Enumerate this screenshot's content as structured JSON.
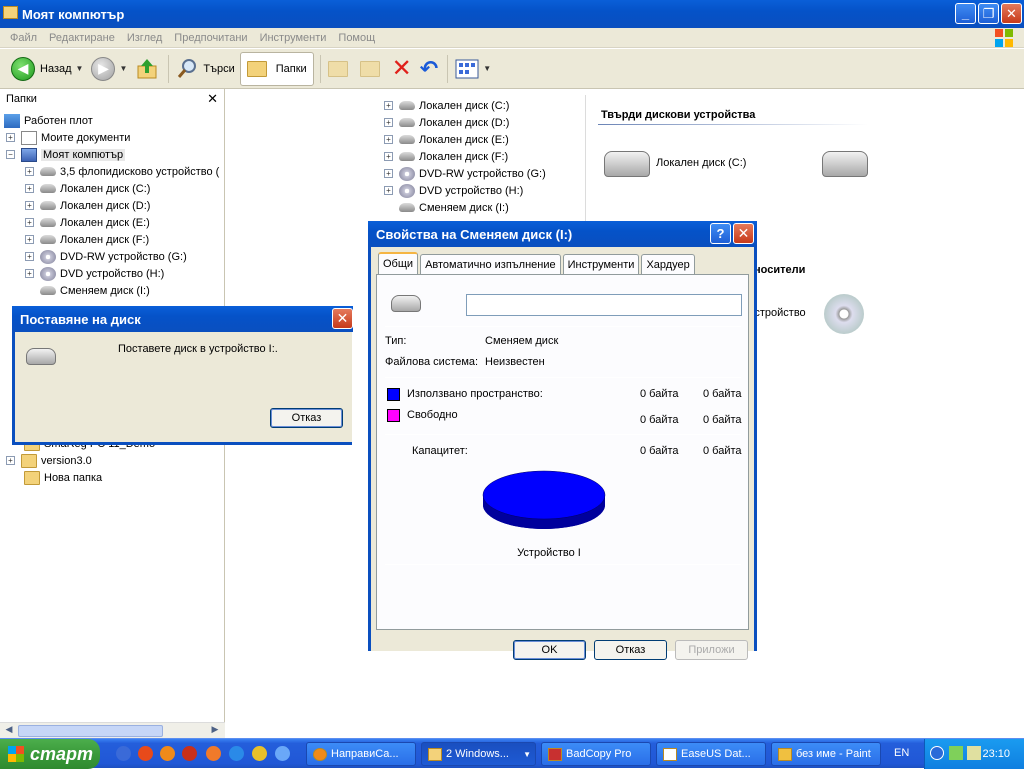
{
  "window": {
    "title": "Моят компютър"
  },
  "menu": [
    "Файл",
    "Редактиране",
    "Изглед",
    "Предпочитани",
    "Инструменти",
    "Помощ"
  ],
  "toolbar": {
    "back": "Назад",
    "search": "Търси",
    "folders": "Папки"
  },
  "folders_pane": {
    "title": "Папки",
    "items": [
      {
        "label": "Работен плот",
        "icon": "desktop-icon"
      },
      {
        "label": "Моите документи",
        "icon": "documents-icon"
      },
      {
        "label": "Моят компютър",
        "icon": "computer-icon"
      },
      {
        "label": "3,5 флопидисково устройство (",
        "icon": "floppy-icon"
      },
      {
        "label": "Локален диск (C:)",
        "icon": "drive-icon"
      },
      {
        "label": "Локален диск (D:)",
        "icon": "drive-icon"
      },
      {
        "label": "Локален диск (E:)",
        "icon": "drive-icon"
      },
      {
        "label": "Локален диск (F:)",
        "icon": "drive-icon"
      },
      {
        "label": "DVD-RW устройство (G:)",
        "icon": "cd-icon"
      },
      {
        "label": "DVD устройство (H:)",
        "icon": "cd-icon"
      },
      {
        "label": "Сменяем диск (I:)",
        "icon": "drive-icon"
      },
      {
        "label": "SmaReg PC 11_Demo",
        "icon": "folder-icon"
      },
      {
        "label": "version3.0",
        "icon": "folder-icon"
      },
      {
        "label": "Нова папка",
        "icon": "folder-icon"
      }
    ]
  },
  "content": {
    "tree_items": [
      "Локален диск (C:)",
      "Локален диск (D:)",
      "Локален диск (E:)",
      "Локален диск (F:)",
      "DVD-RW устройство (G:)",
      "DVD устройство (H:)",
      "Сменяем диск (I:)"
    ],
    "hard_drives_header": "Твърди дискови устройства",
    "drive_c": "Локален диск (C:)",
    "removable_header_partial": "носители",
    "device_partial": "устройство"
  },
  "insert_dialog": {
    "title": "Поставяне на диск",
    "message": "Поставете диск в устройство I:.",
    "cancel": "Отказ"
  },
  "props_dialog": {
    "title": "Свойства на Сменяем диск (I:)",
    "tabs": [
      "Общи",
      "Автоматично изпълнение",
      "Инструменти",
      "Хардуер"
    ],
    "name_value": "",
    "type_label": "Тип:",
    "type_value": "Сменяем диск",
    "fs_label": "Файлова система:",
    "fs_value": "Неизвестен",
    "used_label": "Използвано пространство:",
    "used_bytes": "0 байта",
    "used_size": "0 байта",
    "free_label": "Свободно",
    "free_bytes": "0 байта",
    "free_size": "0 байта",
    "cap_label": "Капацитет:",
    "cap_bytes": "0 байта",
    "cap_size": "0 байта",
    "device_label": "Устройство I",
    "ok": "OK",
    "cancel": "Отказ",
    "apply": "Приложи",
    "used_color": "#0000ff",
    "free_color": "#ff00ff"
  },
  "taskbar": {
    "start": "старт",
    "items": [
      "НаправиСа...",
      "2 Windows...",
      "BadCopy Pro",
      "EaseUS Dat...",
      "без име - Paint"
    ],
    "lang": "EN",
    "clock": "23:10"
  }
}
